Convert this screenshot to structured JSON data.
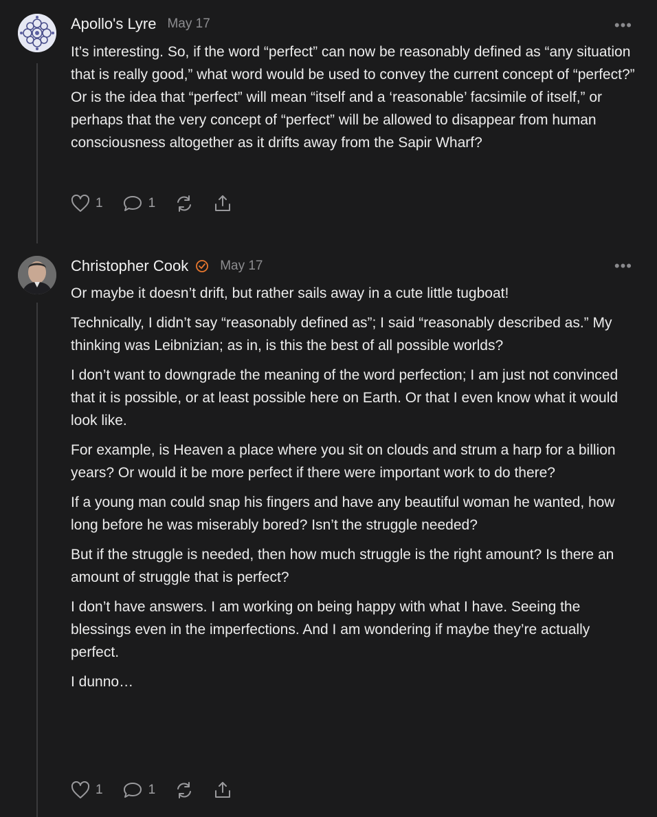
{
  "comments": [
    {
      "author": "Apollo's Lyre",
      "date": "May 17",
      "verified": false,
      "avatar": "kaleidoscope-pattern-avatar",
      "more_label": "•••",
      "paragraphs": [
        "It’s interesting. So, if the word “perfect” can now be reasonably defined as “any situation that is really good,” what word would be used to convey the current concept of “perfect?” Or is the idea that “perfect” will mean “itself and a ‘reasonable’ facsimile of itself,” or perhaps that the very concept of “perfect” will be allowed to disappear from human consciousness altogether as it drifts away from the Sapir Wharf?"
      ],
      "likes": "1",
      "replies": "1"
    },
    {
      "author": "Christopher Cook",
      "date": "May 17",
      "verified": true,
      "avatar": "photo-avatar",
      "more_label": "•••",
      "paragraphs": [
        "Or maybe it doesn’t drift, but rather sails away in a cute little tugboat!",
        "Technically, I didn’t say “reasonably defined as”; I said “reasonably described as.” My thinking was Leibnizian; as in, is this the best of all possible worlds?",
        "I don’t want to downgrade the meaning of the word perfection; I am just not convinced that it is possible, or at least possible here on Earth. Or that I even know what it would look like.",
        "For example, is Heaven a place where you sit on clouds and strum a harp for a billion years? Or would it be more perfect if there were important work to do there?",
        "If a young man could snap his fingers and have any beautiful woman he wanted, how long before he was miserably bored? Isn’t the struggle needed?",
        "But if the struggle is needed, then how much struggle is the right amount? Is there an amount of struggle that is perfect?",
        "I don’t have answers. I am working on being happy with what I have. Seeing the blessings even in the imperfections. And I am wondering if maybe they’re actually perfect.",
        "I dunno…"
      ],
      "likes": "1",
      "replies": "1"
    }
  ],
  "icons": {
    "like": "heart-icon",
    "reply": "comment-bubble-icon",
    "restack": "restack-icon",
    "share": "share-icon",
    "more": "more-dots-icon",
    "verified": "verified-check-icon"
  },
  "colors": {
    "background": "#1b1b1c",
    "text": "#ececec",
    "muted": "#8d8d90",
    "verified_accent": "#e8772e"
  }
}
